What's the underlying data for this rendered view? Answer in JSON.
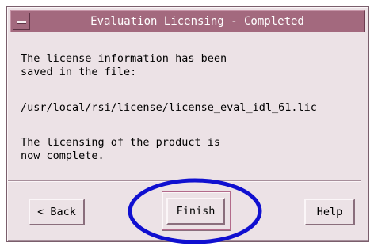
{
  "window": {
    "title": "Evaluation Licensing - Completed"
  },
  "content": {
    "message_line1": "The license information has been",
    "message_line2": "saved in the file:",
    "file_path": "/usr/local/rsi/license/license_eval_idl_61.lic",
    "status_line1": "The licensing of the product is",
    "status_line2": "now complete."
  },
  "buttons": {
    "back_label": "< Back",
    "finish_label": "Finish",
    "help_label": "Help"
  },
  "colors": {
    "title_bar": "#a3697e",
    "dialog_background": "#ece2e6",
    "annotation": "#1010d0"
  },
  "icons": {
    "window_menu": "window-menu-icon"
  }
}
